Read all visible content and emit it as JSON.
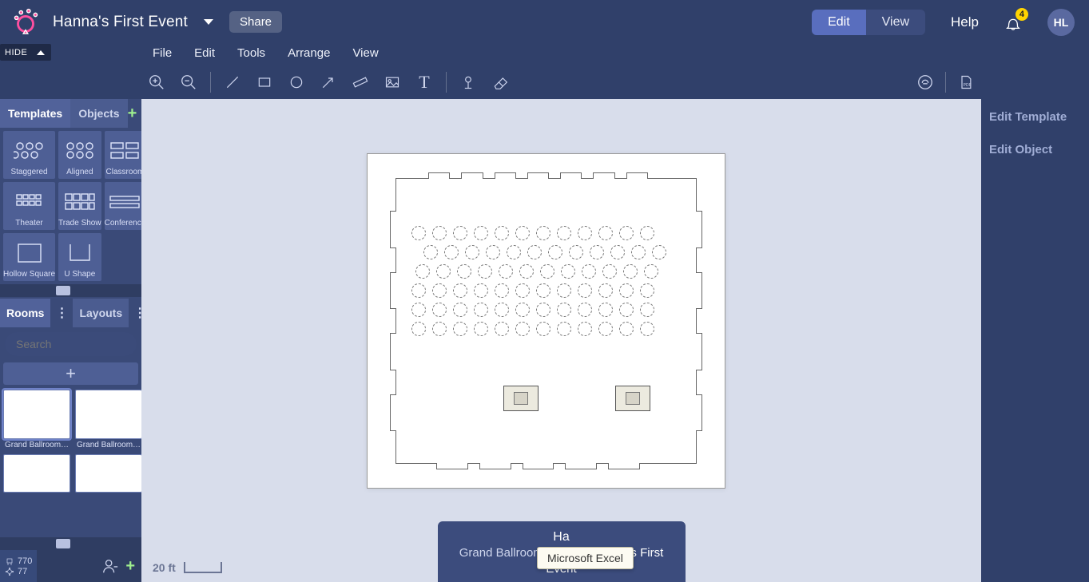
{
  "header": {
    "title": "Hanna's First Event",
    "share_label": "Share",
    "edit_label": "Edit",
    "view_label": "View",
    "help_label": "Help",
    "notif_count": "4",
    "avatar": "HL"
  },
  "hidebar": {
    "hide_label": "HIDE"
  },
  "menu": {
    "file": "File",
    "edit": "Edit",
    "tools": "Tools",
    "arrange": "Arrange",
    "view": "View"
  },
  "sidebar": {
    "tabs": {
      "templates": "Templates",
      "objects": "Objects"
    },
    "templates": [
      {
        "label": "Staggered"
      },
      {
        "label": "Aligned"
      },
      {
        "label": "Classroom"
      },
      {
        "label": "Theater"
      },
      {
        "label": "Trade Show"
      },
      {
        "label": "Conference"
      },
      {
        "label": "Hollow Square"
      },
      {
        "label": "U Shape"
      }
    ],
    "rooms_tab": "Rooms",
    "layouts_tab": "Layouts",
    "search_placeholder": "Search",
    "thumbs": [
      {
        "label": "Grand Ballroom…"
      },
      {
        "label": "Grand Ballroom…"
      },
      {
        "label": ""
      },
      {
        "label": ""
      }
    ],
    "chairs": {
      "count1": "770",
      "count2": "77"
    }
  },
  "right": {
    "edit_template": "Edit Template",
    "edit_object": "Edit Object"
  },
  "canvas": {
    "scale_label": "20 ft",
    "label_line1": "Ha",
    "label_line2a": "Grand Ballroom Copy",
    "label_line2b": "for",
    "label_line2c": "anna's First Event"
  },
  "tooltip": {
    "text": "Microsoft Excel"
  }
}
